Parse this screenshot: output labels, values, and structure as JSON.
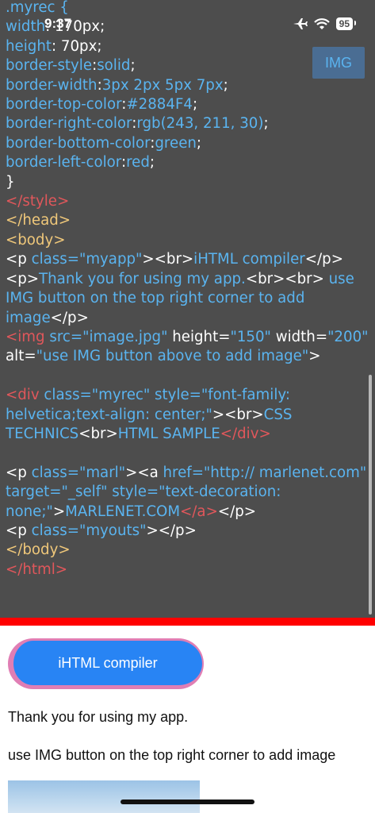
{
  "status_bar": {
    "time": "9:37",
    "battery": "95"
  },
  "toolbar": {
    "img_button": "IMG"
  },
  "code_lines": [
    [
      {
        "t": ".myrec {",
        "c": "b"
      }
    ],
    [
      {
        "t": "width",
        "c": "b"
      },
      {
        "t": ": 170px;",
        "c": "w"
      }
    ],
    [
      {
        "t": "height",
        "c": "b"
      },
      {
        "t": ": 70px;",
        "c": "w"
      }
    ],
    [
      {
        "t": "border-style",
        "c": "b"
      },
      {
        "t": ":",
        "c": "w"
      },
      {
        "t": "solid",
        "c": "b"
      },
      {
        "t": ";",
        "c": "w"
      }
    ],
    [
      {
        "t": "border-width",
        "c": "b"
      },
      {
        "t": ":",
        "c": "w"
      },
      {
        "t": "3px 2px 5px 7px",
        "c": "b"
      },
      {
        "t": ";",
        "c": "w"
      }
    ],
    [
      {
        "t": "border-top-color",
        "c": "b"
      },
      {
        "t": ":",
        "c": "w"
      },
      {
        "t": "#2884F4",
        "c": "b"
      },
      {
        "t": ";",
        "c": "w"
      }
    ],
    [
      {
        "t": "border-right-color",
        "c": "b"
      },
      {
        "t": ":",
        "c": "w"
      },
      {
        "t": "rgb(243, 211, 30)",
        "c": "b"
      },
      {
        "t": ";",
        "c": "w"
      }
    ],
    [
      {
        "t": "border-bottom-color",
        "c": "b"
      },
      {
        "t": ":",
        "c": "w"
      },
      {
        "t": "green",
        "c": "b"
      },
      {
        "t": ";",
        "c": "w"
      }
    ],
    [
      {
        "t": "border-left-color",
        "c": "b"
      },
      {
        "t": ":",
        "c": "w"
      },
      {
        "t": "red",
        "c": "b"
      },
      {
        "t": ";",
        "c": "w"
      }
    ],
    [
      {
        "t": "}",
        "c": "w"
      }
    ],
    [
      {
        "t": "</style>",
        "c": "r"
      }
    ],
    [
      {
        "t": "</head>",
        "c": "y"
      }
    ],
    [
      {
        "t": "<body>",
        "c": "y"
      }
    ],
    [
      {
        "t": "<p ",
        "c": "w"
      },
      {
        "t": "class=\"myapp\"",
        "c": "b"
      },
      {
        "t": "><br>",
        "c": "w"
      },
      {
        "t": "iHTML compiler",
        "c": "b"
      },
      {
        "t": "</p>",
        "c": "w"
      }
    ],
    [
      {
        "t": "<p>",
        "c": "w"
      },
      {
        "t": "Thank you for using my app.",
        "c": "b"
      },
      {
        "t": "<br><br>",
        "c": "w"
      },
      {
        "t": " use IMG button on the top right corner to add image",
        "c": "b"
      },
      {
        "t": "</p>",
        "c": "w"
      }
    ],
    [
      {
        "t": "<img ",
        "c": "r"
      },
      {
        "t": "src=\"image.jpg\"",
        "c": "b"
      },
      {
        "t": " height=",
        "c": "w"
      },
      {
        "t": "\"150\"",
        "c": "b"
      },
      {
        "t": " width=",
        "c": "w"
      },
      {
        "t": "\"200\"",
        "c": "b"
      },
      {
        "t": " alt=",
        "c": "w"
      },
      {
        "t": "\"use IMG button above to add image\"",
        "c": "b"
      },
      {
        "t": ">",
        "c": "w"
      }
    ],
    [
      {
        "t": "",
        "c": "w"
      }
    ],
    [
      {
        "t": "<div ",
        "c": "r"
      },
      {
        "t": "class=\"myrec\" style=\"font-family: helvetica;text-align: center;\"",
        "c": "b"
      },
      {
        "t": "><br>",
        "c": "w"
      },
      {
        "t": "CSS TECHNICS",
        "c": "b"
      },
      {
        "t": "<br>",
        "c": "w"
      },
      {
        "t": "HTML SAMPLE",
        "c": "b"
      },
      {
        "t": "</div>",
        "c": "r"
      }
    ],
    [
      {
        "t": "",
        "c": "w"
      }
    ],
    [
      {
        "t": "<p ",
        "c": "w"
      },
      {
        "t": "class=\"marl\"",
        "c": "b"
      },
      {
        "t": "><a ",
        "c": "w"
      },
      {
        "t": "href=\"http:// marlenet.com\" target=\"_self\" style=\"text-decoration: none;\"",
        "c": "b"
      },
      {
        "t": ">",
        "c": "w"
      },
      {
        "t": "MARLENET.COM",
        "c": "b"
      },
      {
        "t": "</a>",
        "c": "r"
      },
      {
        "t": "</p>",
        "c": "w"
      }
    ],
    [
      {
        "t": "<p ",
        "c": "w"
      },
      {
        "t": "class=\"myouts\"",
        "c": "b"
      },
      {
        "t": "></p>",
        "c": "w"
      }
    ],
    [
      {
        "t": "</body>",
        "c": "y"
      }
    ],
    [
      {
        "t": "</html>",
        "c": "r"
      }
    ]
  ],
  "preview": {
    "app_title": "iHTML compiler",
    "thanks_text": "Thank you for using my app.",
    "img_hint_text": "use IMG button on the top right corner to add image"
  }
}
